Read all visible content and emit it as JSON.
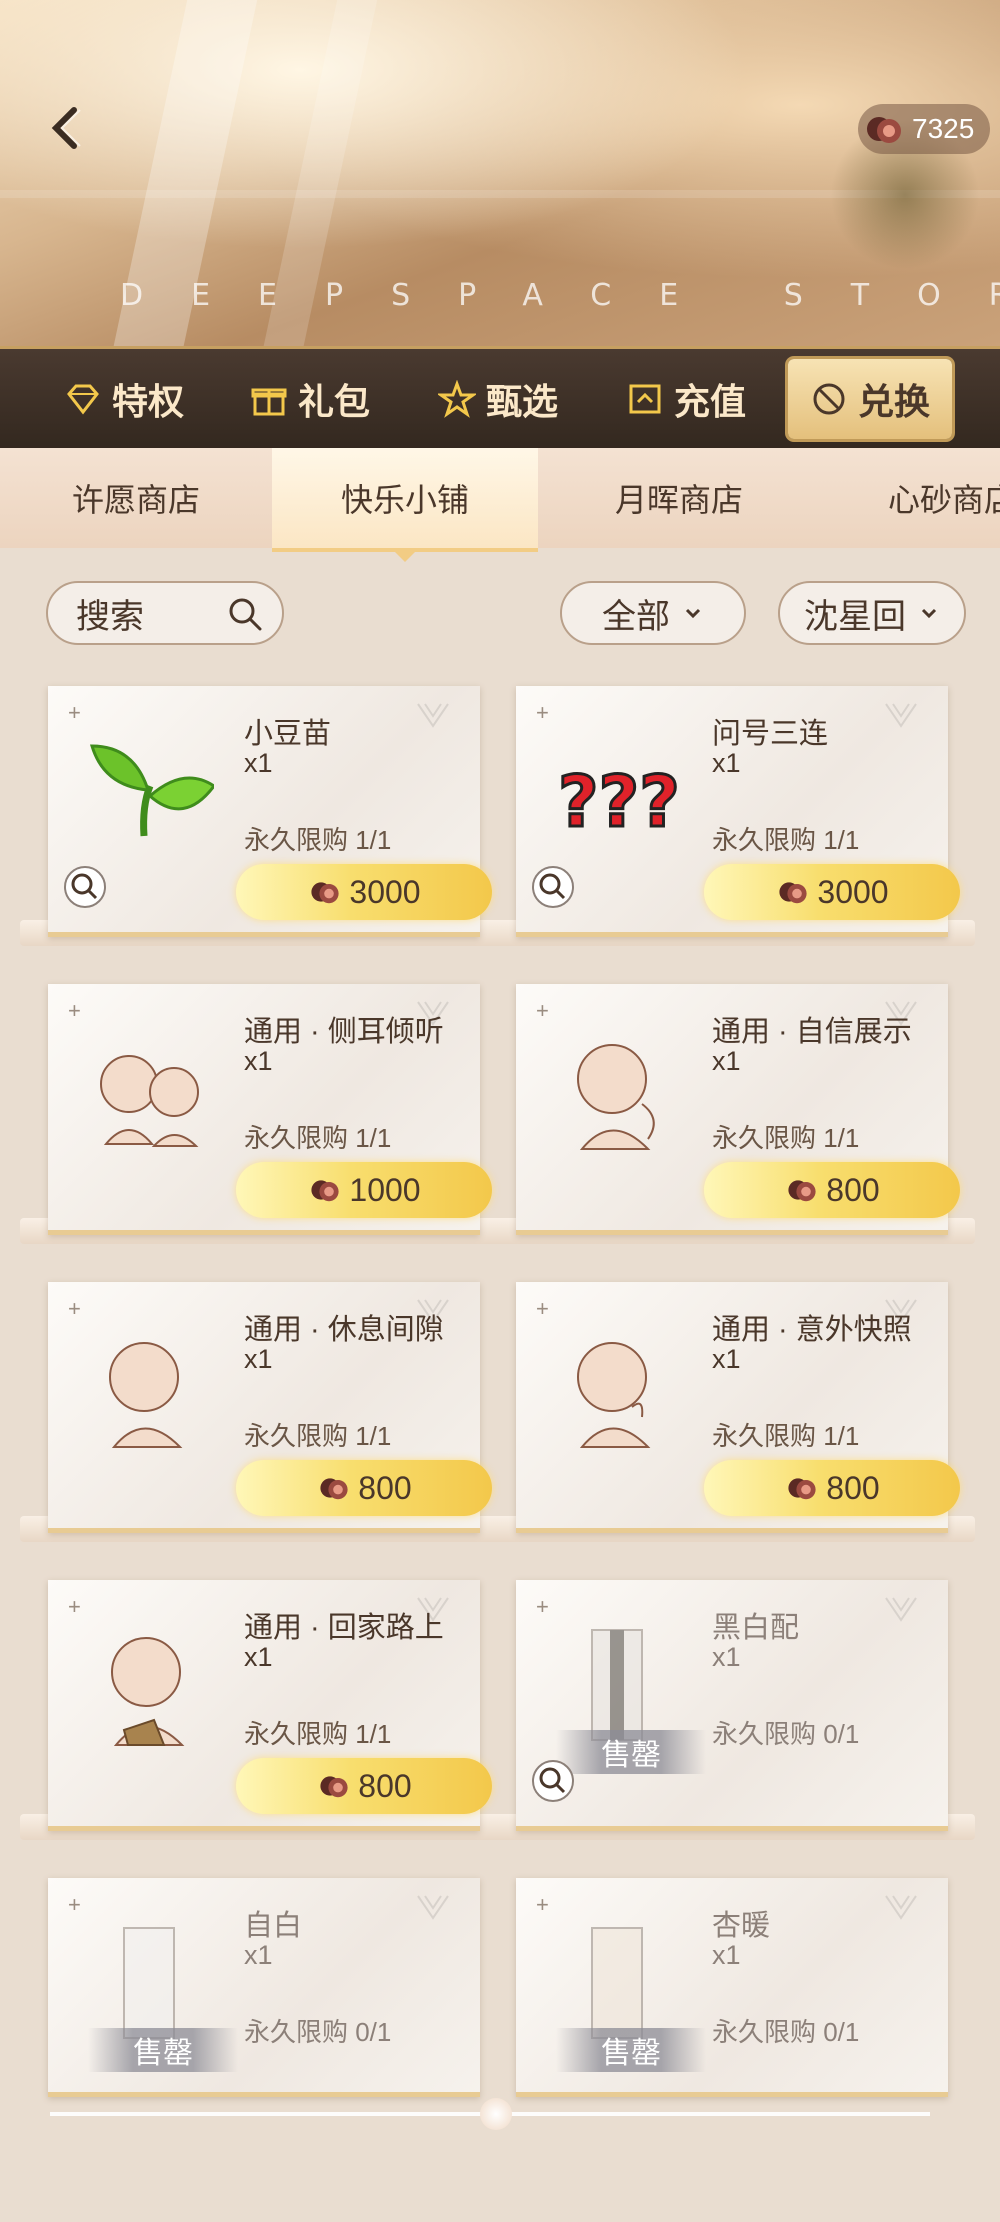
{
  "header": {
    "banner_text": "DEEPSPACE STORE",
    "currency_amount": "7325"
  },
  "nav": {
    "tabs": [
      {
        "label": "特权",
        "icon": "diamond-icon"
      },
      {
        "label": "礼包",
        "icon": "gift-icon"
      },
      {
        "label": "甄选",
        "icon": "star-icon"
      },
      {
        "label": "充值",
        "icon": "topup-icon"
      },
      {
        "label": "兑换",
        "icon": "exchange-icon",
        "active": true
      }
    ]
  },
  "subtabs": [
    "许愿商店",
    "快乐小铺",
    "月晖商店",
    "心砂商店"
  ],
  "subtab_active": "快乐小铺",
  "filters": {
    "search_placeholder": "搜索",
    "category": "全部",
    "character": "沈星回"
  },
  "items": [
    {
      "name": "小豆苗",
      "qty": "x1",
      "limit": "永久限购 1/1",
      "price": "3000",
      "thumb": "sprout-icon"
    },
    {
      "name": "问号三连",
      "qty": "x1",
      "limit": "永久限购 1/1",
      "price": "3000",
      "thumb": "question-marks-icon"
    },
    {
      "name": "通用 · 侧耳倾听",
      "qty": "x1",
      "limit": "永久限购 1/1",
      "price": "1000",
      "thumb": "chibi-listen-icon"
    },
    {
      "name": "通用 · 自信展示",
      "qty": "x1",
      "limit": "永久限购 1/1",
      "price": "800",
      "thumb": "chibi-confident-icon"
    },
    {
      "name": "通用 · 休息间隙",
      "qty": "x1",
      "limit": "永久限购 1/1",
      "price": "800",
      "thumb": "chibi-rest-icon"
    },
    {
      "name": "通用 · 意外快照",
      "qty": "x1",
      "limit": "永久限购 1/1",
      "price": "800",
      "thumb": "chibi-snapshot-icon"
    },
    {
      "name": "通用 · 回家路上",
      "qty": "x1",
      "limit": "永久限购 1/1",
      "price": "800",
      "thumb": "chibi-home-icon"
    },
    {
      "name": "黑白配",
      "qty": "x1",
      "limit": "永久限购 0/1",
      "sold_out": "售罄",
      "thumb": "outfit-blackwhite-icon"
    },
    {
      "name": "自白",
      "qty": "x1",
      "limit": "永久限购 0/1",
      "sold_out": "售罄",
      "thumb": "outfit-white-icon"
    },
    {
      "name": "杏暖",
      "qty": "x1",
      "limit": "永久限购 0/1",
      "sold_out": "售罄",
      "thumb": "outfit-apricot-icon"
    }
  ],
  "colors": {
    "accent_gold": "#f3c84b",
    "nav_bg": "#33281f",
    "text_brown": "#4a372a"
  }
}
